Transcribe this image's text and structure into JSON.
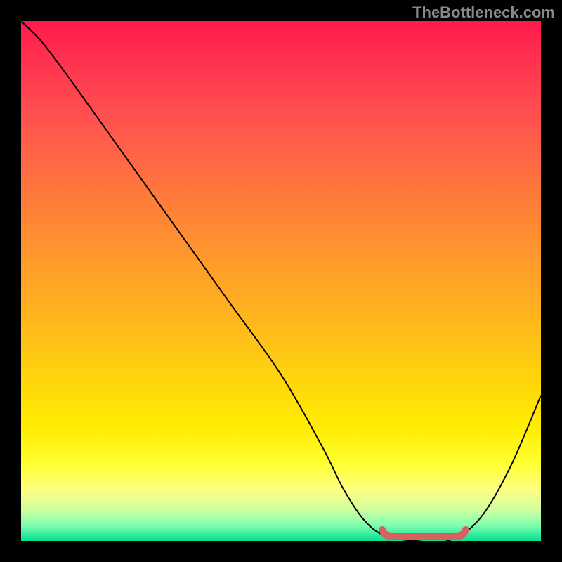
{
  "watermark": "TheBottleneck.com",
  "chart_data": {
    "type": "line",
    "title": "",
    "xlabel": "",
    "ylabel": "",
    "xlim": [
      0,
      100
    ],
    "ylim": [
      0,
      100
    ],
    "x": [
      0,
      4,
      10,
      20,
      30,
      40,
      50,
      58,
      62,
      66,
      70,
      76,
      82,
      88,
      94,
      100
    ],
    "values": [
      100,
      96,
      88,
      74,
      60,
      46,
      32,
      18,
      10,
      4,
      1,
      0,
      0,
      4,
      14,
      28
    ],
    "optimal_range": {
      "x_start": 70,
      "x_end": 85,
      "y": 0
    },
    "gradient_colors": {
      "top": "#ff1a4d",
      "middle": "#ffec00",
      "bottom": "#00e090"
    }
  }
}
